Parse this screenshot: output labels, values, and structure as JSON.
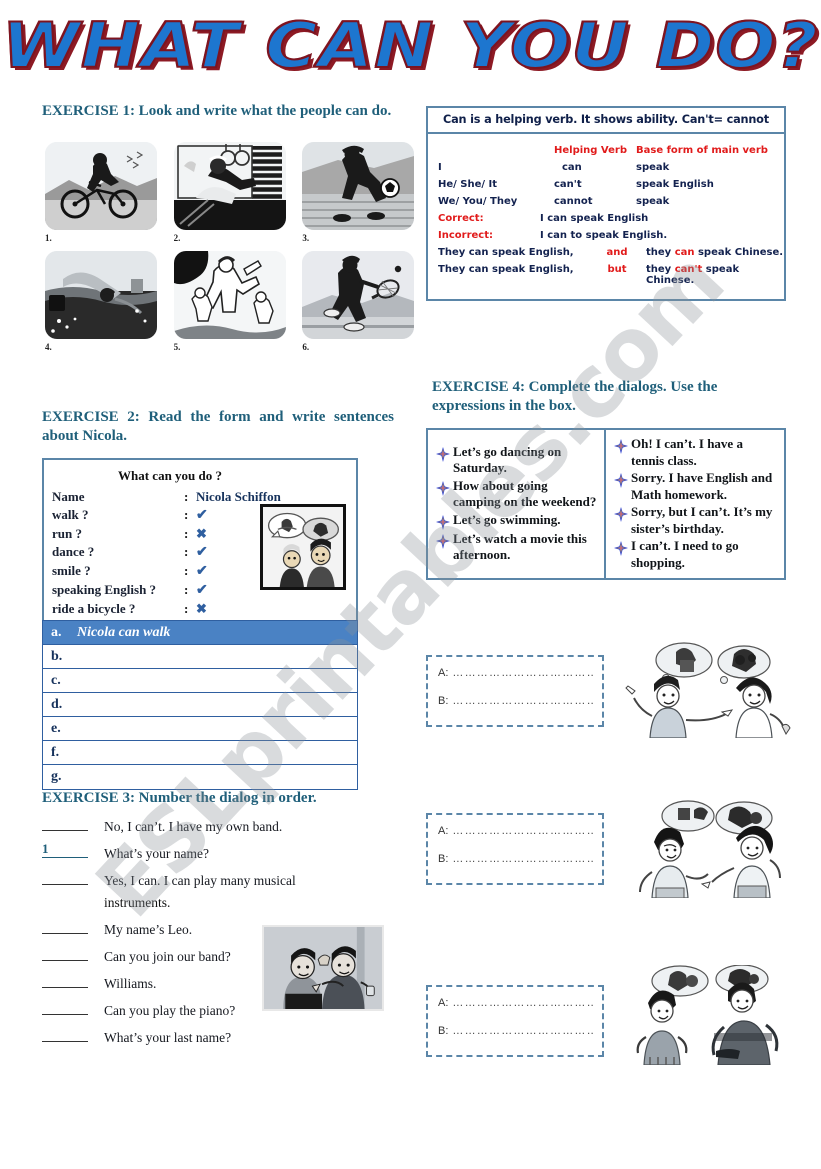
{
  "title": "WHAT CAN YOU DO?",
  "watermark": "ESLprintables.com",
  "colors": {
    "heading": "#1f5f7a",
    "title_fill": "#1d76cf",
    "title_outline": "#8d1a24",
    "box_border": "#5b86a8",
    "highlight_row": "#4a82c4",
    "accent_red": "#e11b1b"
  },
  "exercise1": {
    "heading": "EXERCISE 1: Look and write what the people can do.",
    "pictures": [
      {
        "num": "1.",
        "icon": "cycling-icon",
        "caption": "riding a bicycle"
      },
      {
        "num": "2.",
        "icon": "guitar-icon",
        "caption": "playing the guitar"
      },
      {
        "num": "3.",
        "icon": "soccer-icon",
        "caption": "playing soccer"
      },
      {
        "num": "4.",
        "icon": "swimming-icon",
        "caption": "swimming"
      },
      {
        "num": "5.",
        "icon": "karate-icon",
        "caption": "doing karate"
      },
      {
        "num": "6.",
        "icon": "tennis-icon",
        "caption": "playing tennis"
      }
    ]
  },
  "grammar": {
    "title": "Can is a helping verb. It shows ability. Can't= cannot",
    "header": {
      "col1": "",
      "col2": "Helping Verb",
      "col3": "Base form of main verb"
    },
    "rows": [
      {
        "col1": "I",
        "col2": "can",
        "col3": "speak"
      },
      {
        "col1": "He/ She/ It",
        "col2": "can't",
        "col3": "speak  English"
      },
      {
        "col1": "We/ You/ They",
        "col2": "cannot",
        "col3": "speak"
      }
    ],
    "examples": [
      {
        "label": "Correct:",
        "text": "I can speak English"
      },
      {
        "label": "Incorrect:",
        "text": "I can to speak English."
      }
    ],
    "conjunctions": [
      {
        "clause1": "They can speak English,",
        "conj": "and",
        "clause2_pre": "they ",
        "clause2_hl": "can",
        "clause2_post": " speak  Chinese."
      },
      {
        "clause1": "They can speak English,",
        "conj": "but",
        "clause2_pre": "they ",
        "clause2_hl": "can't",
        "clause2_post": "  speak  Chinese."
      }
    ]
  },
  "exercise2": {
    "heading": "EXERCISE 2: Read the form and write sentences about Nicola.",
    "form": {
      "title": "What can you do ?",
      "rows": [
        {
          "label": "Name",
          "colon": ":",
          "value": "Nicola Schiffon",
          "mark": ""
        },
        {
          "label": "walk ?",
          "colon": ":",
          "value": "",
          "mark": "check"
        },
        {
          "label": "run ?",
          "colon": ":",
          "value": "",
          "mark": "cross"
        },
        {
          "label": "dance ?",
          "colon": ":",
          "value": "",
          "mark": "check"
        },
        {
          "label": "smile ?",
          "colon": ":",
          "value": "",
          "mark": "check"
        },
        {
          "label": "speaking English ?",
          "colon": ":",
          "value": "",
          "mark": "check"
        },
        {
          "label": "ride a bicycle ?",
          "colon": ":",
          "value": "",
          "mark": "cross"
        }
      ],
      "check_glyph": "✔",
      "cross_glyph": "✖",
      "thumb_icon": "two-kids-thinking-icon"
    },
    "answer_rows": [
      {
        "letter": "a.",
        "text": "Nicola can walk",
        "filled": true
      },
      {
        "letter": "b.",
        "text": "",
        "filled": false
      },
      {
        "letter": "c.",
        "text": "",
        "filled": false
      },
      {
        "letter": "d.",
        "text": "",
        "filled": false
      },
      {
        "letter": "e.",
        "text": "",
        "filled": false
      },
      {
        "letter": "f.",
        "text": "",
        "filled": false
      },
      {
        "letter": "g.",
        "text": "",
        "filled": false
      }
    ]
  },
  "exercise3": {
    "heading": "EXERCISE 3: Number the dialog in order.",
    "lines": [
      {
        "number": "",
        "text": "No, I can’t. I have my own band.",
        "cont": ""
      },
      {
        "number": "1",
        "text": "What’s your name?",
        "cont": ""
      },
      {
        "number": "",
        "text": "Yes, I can. I can play many musical",
        "cont": "instruments."
      },
      {
        "number": "",
        "text": "My name’s Leo.",
        "cont": ""
      },
      {
        "number": "",
        "text": "Can you join our band?",
        "cont": ""
      },
      {
        "number": "",
        "text": "Williams.",
        "cont": ""
      },
      {
        "number": "",
        "text": "Can you play the piano?",
        "cont": ""
      },
      {
        "number": "",
        "text": "What’s your last name?",
        "cont": ""
      }
    ],
    "picture_icon": "two-boys-talking-icon"
  },
  "exercise4": {
    "heading": "EXERCISE 4: Complete the dialogs. Use the expressions in the box.",
    "expressions_left": [
      "Let’s go dancing on Saturday.",
      " How about going camping on the weekend?",
      " Let’s go swimming.",
      " Let’s watch a movie this afternoon."
    ],
    "expressions_right": [
      "Oh! I can’t. I have a tennis class.",
      "Sorry. I have English and Math homework.",
      "Sorry, but I can’t. It’s my sister’s birthday.",
      "I can’t. I need to go shopping."
    ],
    "bullet_icon": "sparkle-bullet-icon",
    "dialogs": [
      {
        "a_label": "A:",
        "b_label": "B:",
        "dots": "………………………………",
        "picture_icon": "girls-talking-icon-1"
      },
      {
        "a_label": "A:",
        "b_label": "B:",
        "dots": "………………………………",
        "picture_icon": "girls-talking-icon-2"
      },
      {
        "a_label": "A:",
        "b_label": "B:",
        "dots": "………………………………",
        "picture_icon": "girl-boy-talking-icon-3"
      }
    ]
  }
}
